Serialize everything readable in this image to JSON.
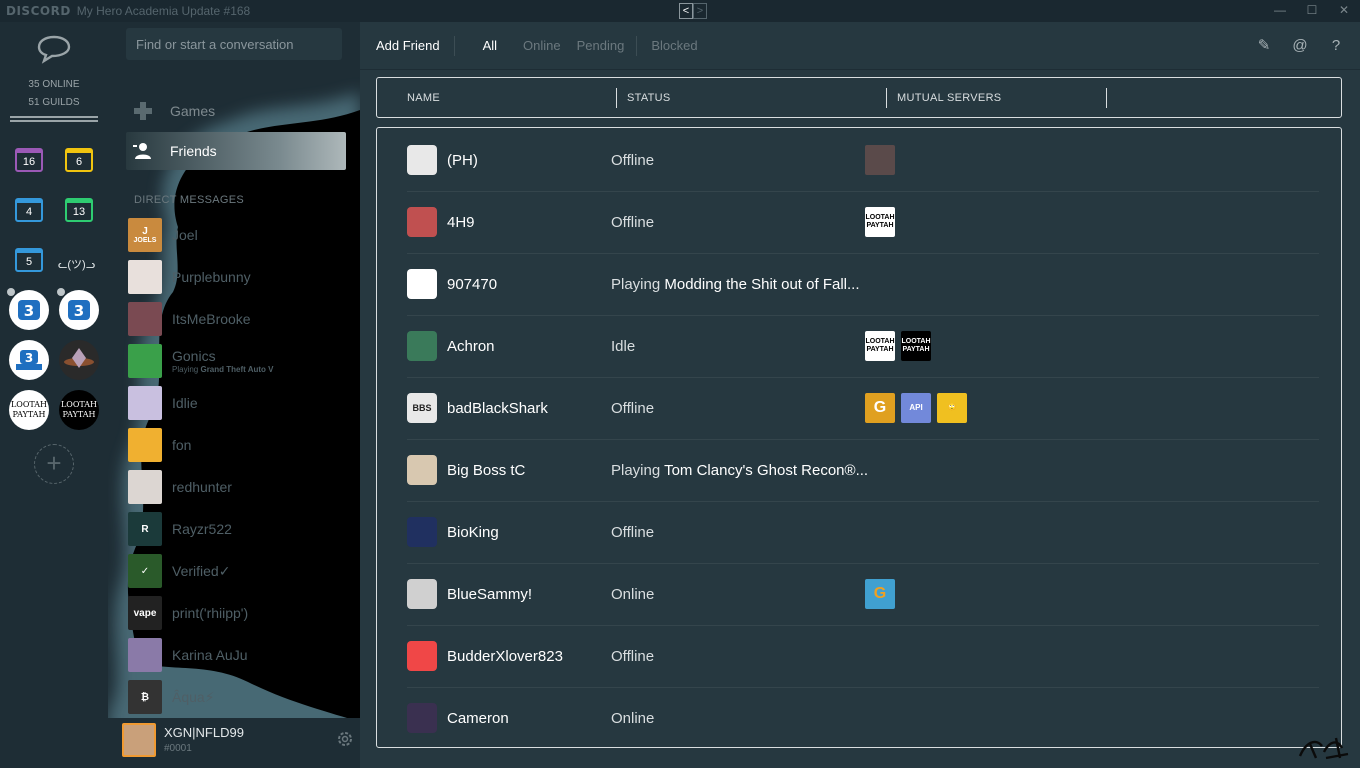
{
  "window": {
    "app": "DISCORD",
    "title": "My Hero Academia Update #168",
    "back_arrow": "<",
    "forward_arrow": ">",
    "controls": {
      "minimize": "—",
      "maximize": "☐",
      "close": "✕"
    }
  },
  "guilds": {
    "online": "35 ONLINE",
    "guild_count": "51 GUILDS",
    "folders": [
      {
        "count": "16",
        "color": "#9b59b6"
      },
      {
        "count": "6",
        "color": "#f1c40f"
      },
      {
        "count": "4",
        "color": "#3498db"
      },
      {
        "count": "13",
        "color": "#2ecc71"
      },
      {
        "count": "5",
        "color": "#3498db"
      }
    ],
    "lenny_face": "ᓚ(ツ)ᓗ",
    "lootah_text_1": "LOOTAH",
    "lootah_text_2": "PAYTAH",
    "add_label": "+"
  },
  "sidebar": {
    "search_placeholder": "Find or start a conversation",
    "nav": {
      "games": "Games",
      "friends": "Friends"
    },
    "dm_header": "DIRECT MESSAGES",
    "dms": [
      {
        "name": "Joel",
        "avatar_text": "J",
        "avatar_sub": "JOELS",
        "color": "#c98a3e"
      },
      {
        "name": "Purplebunny",
        "avatar_text": "",
        "avatar_sub": "",
        "color": "#e8e0dc"
      },
      {
        "name": "ItsMeBrooke",
        "avatar_text": "",
        "avatar_sub": "",
        "color": "#7a4a52"
      },
      {
        "name": "Gonics",
        "avatar_text": "",
        "avatar_sub": "",
        "color": "#3aa04a",
        "activity_prefix": "Playing ",
        "activity": "Grand Theft Auto V"
      },
      {
        "name": "Idlie",
        "avatar_text": "",
        "avatar_sub": "",
        "color": "#c9c0e0"
      },
      {
        "name": "fon",
        "avatar_text": "",
        "avatar_sub": "",
        "color": "#f0b030"
      },
      {
        "name": "redhunter",
        "avatar_text": "",
        "avatar_sub": "",
        "color": "#dcd6d2"
      },
      {
        "name": "Rayzr522",
        "avatar_text": "R",
        "avatar_sub": "",
        "color": "#1b3a3a"
      },
      {
        "name": "Verified✓",
        "avatar_text": "✓",
        "avatar_sub": "",
        "color": "#2a5a2a"
      },
      {
        "name": "print('rhiipp')",
        "avatar_text": "vape",
        "avatar_sub": "",
        "color": "#222222"
      },
      {
        "name": "Karina AuJu",
        "avatar_text": "",
        "avatar_sub": "",
        "color": "#8a7aa8"
      },
      {
        "name": "Âqua⚡",
        "avatar_text": "₿",
        "avatar_sub": "",
        "color": "#333333"
      }
    ],
    "user": {
      "name": "XGN|NFLD99",
      "discriminator": "#0001"
    }
  },
  "main": {
    "topbar": {
      "add_friend": "Add Friend",
      "tabs": [
        "All",
        "Online",
        "Pending",
        "Blocked"
      ],
      "active_tab": "All",
      "icons": {
        "new_group": "✎",
        "mentions": "@",
        "help": "?"
      }
    },
    "columns": {
      "name": "NAME",
      "status": "STATUS",
      "mutual": "MUTUAL SERVERS"
    },
    "friends": [
      {
        "name": "(PH)",
        "status": "Offline",
        "game": "",
        "avatar_color": "#e8e8e8",
        "avatar_text": "",
        "servers": [
          {
            "text": "",
            "bg": "#5a4a4a",
            "fg": "#ffffff"
          }
        ]
      },
      {
        "name": "4H9",
        "status": "Offline",
        "game": "",
        "avatar_color": "#c05050",
        "avatar_text": "",
        "servers": [
          {
            "text": "LOOTAH PAYTAH",
            "bg": "#ffffff",
            "fg": "#000000"
          }
        ]
      },
      {
        "name": "907470",
        "status": "Playing ",
        "game": "Modding the Shit out of Fall...",
        "avatar_color": "#ffffff",
        "avatar_text": "",
        "servers": []
      },
      {
        "name": "Achron",
        "status": "Idle",
        "game": "",
        "avatar_color": "#3a7a5a",
        "avatar_text": "",
        "servers": [
          {
            "text": "LOOTAH PAYTAH",
            "bg": "#ffffff",
            "fg": "#000000"
          },
          {
            "text": "LOOTAH PAYTAH",
            "bg": "#000000",
            "fg": "#ffffff"
          }
        ]
      },
      {
        "name": "badBlackShark",
        "status": "Offline",
        "game": "",
        "avatar_color": "#e8e8e8",
        "avatar_text": "BBS",
        "servers": [
          {
            "text": "G",
            "bg": "#e0a020",
            "fg": "#ffffff"
          },
          {
            "text": "API",
            "bg": "#7289da",
            "fg": "#ffffff"
          },
          {
            "text": "🙄",
            "bg": "#f0c020",
            "fg": "#000000"
          }
        ]
      },
      {
        "name": "Big Boss tC",
        "status": "Playing ",
        "game": "Tom Clancy's Ghost Recon®...",
        "avatar_color": "#d8c8b0",
        "avatar_text": "",
        "servers": []
      },
      {
        "name": "BioKing",
        "status": "Offline",
        "game": "",
        "avatar_color": "#203060",
        "avatar_text": "",
        "servers": []
      },
      {
        "name": "BlueSammy!",
        "status": "Online",
        "game": "",
        "avatar_color": "#d0d0d0",
        "avatar_text": "",
        "servers": [
          {
            "text": "G",
            "bg": "#40a0d0",
            "fg": "#f0a020"
          }
        ]
      },
      {
        "name": "BudderXlover823",
        "status": "Offline",
        "game": "",
        "avatar_color": "#f04747",
        "avatar_text": "",
        "servers": []
      },
      {
        "name": "Cameron",
        "status": "Online",
        "game": "",
        "avatar_color": "#3a3050",
        "avatar_text": "",
        "servers": []
      }
    ]
  },
  "colors": {
    "accent": "#7289da",
    "friends_highlight": "#aeb8ba",
    "panel_bg": "#263840",
    "rail_bg": "#1e2d35"
  }
}
